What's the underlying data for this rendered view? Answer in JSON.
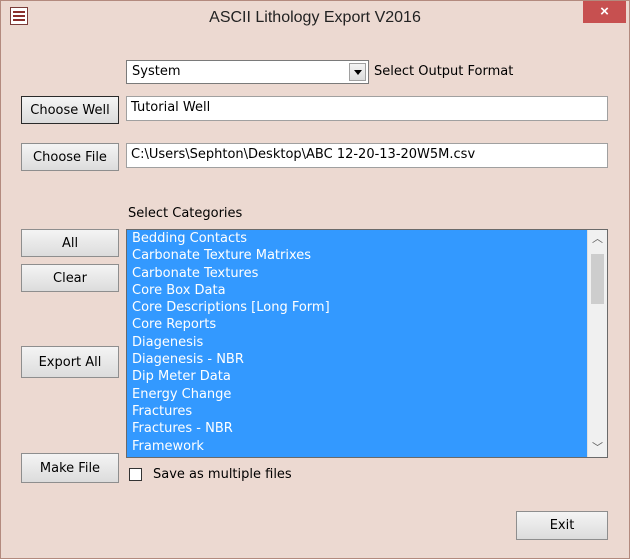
{
  "window": {
    "title": "ASCII Lithology Export V2016",
    "close_glyph": "×"
  },
  "output_format": {
    "selected": "System",
    "label": "Select Output Format"
  },
  "well": {
    "button_label": "Choose Well",
    "value": "Tutorial Well"
  },
  "file": {
    "button_label": "Choose File",
    "value": "C:\\Users\\Sephton\\Desktop\\ABC 12-20-13-20W5M.csv"
  },
  "categories": {
    "label": "Select Categories",
    "items": [
      "Bedding Contacts",
      "Carbonate Texture Matrixes",
      "Carbonate Textures",
      "Core Box Data",
      "Core Descriptions [Long Form]",
      "Core Reports",
      "Diagenesis",
      "Diagenesis - NBR",
      "Dip Meter Data",
      "Energy Change",
      "Fractures",
      "Fractures - NBR",
      "Framework"
    ],
    "selection_color": "#3399ff"
  },
  "buttons": {
    "all": "All",
    "clear": "Clear",
    "export_all": "Export All",
    "make_file": "Make File",
    "exit": "Exit"
  },
  "save_multiple": {
    "label": "Save as multiple files",
    "checked": false
  },
  "icons": {
    "app": "app-icon",
    "dropdown": "chevron-down-icon",
    "scroll_up": "scroll-up-icon",
    "scroll_down": "scroll-down-icon"
  }
}
